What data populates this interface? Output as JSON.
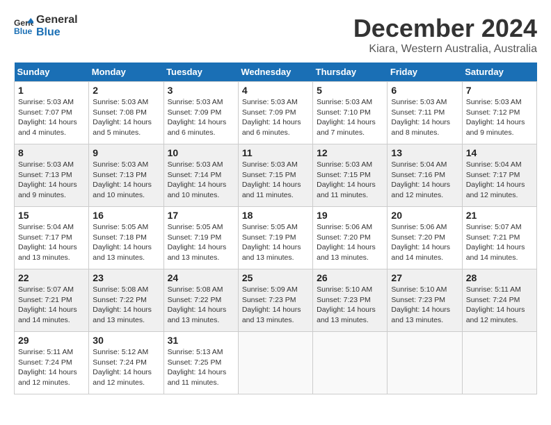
{
  "header": {
    "logo_line1": "General",
    "logo_line2": "Blue",
    "month": "December 2024",
    "location": "Kiara, Western Australia, Australia"
  },
  "weekdays": [
    "Sunday",
    "Monday",
    "Tuesday",
    "Wednesday",
    "Thursday",
    "Friday",
    "Saturday"
  ],
  "weeks": [
    [
      {
        "day": "1",
        "sunrise": "5:03 AM",
        "sunset": "7:07 PM",
        "daylight": "14 hours and 4 minutes."
      },
      {
        "day": "2",
        "sunrise": "5:03 AM",
        "sunset": "7:08 PM",
        "daylight": "14 hours and 5 minutes."
      },
      {
        "day": "3",
        "sunrise": "5:03 AM",
        "sunset": "7:09 PM",
        "daylight": "14 hours and 6 minutes."
      },
      {
        "day": "4",
        "sunrise": "5:03 AM",
        "sunset": "7:09 PM",
        "daylight": "14 hours and 6 minutes."
      },
      {
        "day": "5",
        "sunrise": "5:03 AM",
        "sunset": "7:10 PM",
        "daylight": "14 hours and 7 minutes."
      },
      {
        "day": "6",
        "sunrise": "5:03 AM",
        "sunset": "7:11 PM",
        "daylight": "14 hours and 8 minutes."
      },
      {
        "day": "7",
        "sunrise": "5:03 AM",
        "sunset": "7:12 PM",
        "daylight": "14 hours and 9 minutes."
      }
    ],
    [
      {
        "day": "8",
        "sunrise": "5:03 AM",
        "sunset": "7:13 PM",
        "daylight": "14 hours and 9 minutes."
      },
      {
        "day": "9",
        "sunrise": "5:03 AM",
        "sunset": "7:13 PM",
        "daylight": "14 hours and 10 minutes."
      },
      {
        "day": "10",
        "sunrise": "5:03 AM",
        "sunset": "7:14 PM",
        "daylight": "14 hours and 10 minutes."
      },
      {
        "day": "11",
        "sunrise": "5:03 AM",
        "sunset": "7:15 PM",
        "daylight": "14 hours and 11 minutes."
      },
      {
        "day": "12",
        "sunrise": "5:03 AM",
        "sunset": "7:15 PM",
        "daylight": "14 hours and 11 minutes."
      },
      {
        "day": "13",
        "sunrise": "5:04 AM",
        "sunset": "7:16 PM",
        "daylight": "14 hours and 12 minutes."
      },
      {
        "day": "14",
        "sunrise": "5:04 AM",
        "sunset": "7:17 PM",
        "daylight": "14 hours and 12 minutes."
      }
    ],
    [
      {
        "day": "15",
        "sunrise": "5:04 AM",
        "sunset": "7:17 PM",
        "daylight": "14 hours and 13 minutes."
      },
      {
        "day": "16",
        "sunrise": "5:05 AM",
        "sunset": "7:18 PM",
        "daylight": "14 hours and 13 minutes."
      },
      {
        "day": "17",
        "sunrise": "5:05 AM",
        "sunset": "7:19 PM",
        "daylight": "14 hours and 13 minutes."
      },
      {
        "day": "18",
        "sunrise": "5:05 AM",
        "sunset": "7:19 PM",
        "daylight": "14 hours and 13 minutes."
      },
      {
        "day": "19",
        "sunrise": "5:06 AM",
        "sunset": "7:20 PM",
        "daylight": "14 hours and 13 minutes."
      },
      {
        "day": "20",
        "sunrise": "5:06 AM",
        "sunset": "7:20 PM",
        "daylight": "14 hours and 14 minutes."
      },
      {
        "day": "21",
        "sunrise": "5:07 AM",
        "sunset": "7:21 PM",
        "daylight": "14 hours and 14 minutes."
      }
    ],
    [
      {
        "day": "22",
        "sunrise": "5:07 AM",
        "sunset": "7:21 PM",
        "daylight": "14 hours and 14 minutes."
      },
      {
        "day": "23",
        "sunrise": "5:08 AM",
        "sunset": "7:22 PM",
        "daylight": "14 hours and 13 minutes."
      },
      {
        "day": "24",
        "sunrise": "5:08 AM",
        "sunset": "7:22 PM",
        "daylight": "14 hours and 13 minutes."
      },
      {
        "day": "25",
        "sunrise": "5:09 AM",
        "sunset": "7:23 PM",
        "daylight": "14 hours and 13 minutes."
      },
      {
        "day": "26",
        "sunrise": "5:10 AM",
        "sunset": "7:23 PM",
        "daylight": "14 hours and 13 minutes."
      },
      {
        "day": "27",
        "sunrise": "5:10 AM",
        "sunset": "7:23 PM",
        "daylight": "14 hours and 13 minutes."
      },
      {
        "day": "28",
        "sunrise": "5:11 AM",
        "sunset": "7:24 PM",
        "daylight": "14 hours and 12 minutes."
      }
    ],
    [
      {
        "day": "29",
        "sunrise": "5:11 AM",
        "sunset": "7:24 PM",
        "daylight": "14 hours and 12 minutes."
      },
      {
        "day": "30",
        "sunrise": "5:12 AM",
        "sunset": "7:24 PM",
        "daylight": "14 hours and 12 minutes."
      },
      {
        "day": "31",
        "sunrise": "5:13 AM",
        "sunset": "7:25 PM",
        "daylight": "14 hours and 11 minutes."
      },
      null,
      null,
      null,
      null
    ]
  ],
  "labels": {
    "sunrise": "Sunrise:",
    "sunset": "Sunset:",
    "daylight": "Daylight:"
  }
}
